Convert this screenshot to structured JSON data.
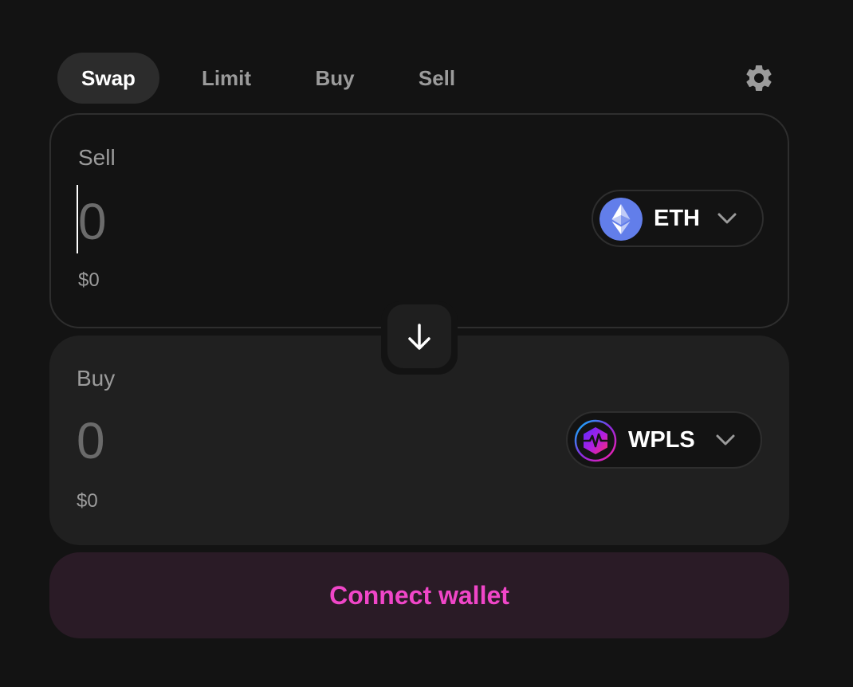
{
  "tabs": [
    {
      "label": "Swap",
      "active": true
    },
    {
      "label": "Limit",
      "active": false
    },
    {
      "label": "Buy",
      "active": false
    },
    {
      "label": "Sell",
      "active": false
    }
  ],
  "settings": {
    "icon": "gear-icon"
  },
  "sell_panel": {
    "label": "Sell",
    "amount": "0",
    "fiat_value": "$0",
    "token": {
      "symbol": "ETH",
      "icon": "ethereum-logo-icon",
      "color": "#627EEA"
    }
  },
  "switch": {
    "icon": "arrow-down-icon"
  },
  "buy_panel": {
    "label": "Buy",
    "amount": "0",
    "fiat_value": "$0",
    "token": {
      "symbol": "WPLS",
      "icon": "pulsechain-logo-icon"
    }
  },
  "connect": {
    "label": "Connect wallet",
    "color": "#F046C8"
  }
}
